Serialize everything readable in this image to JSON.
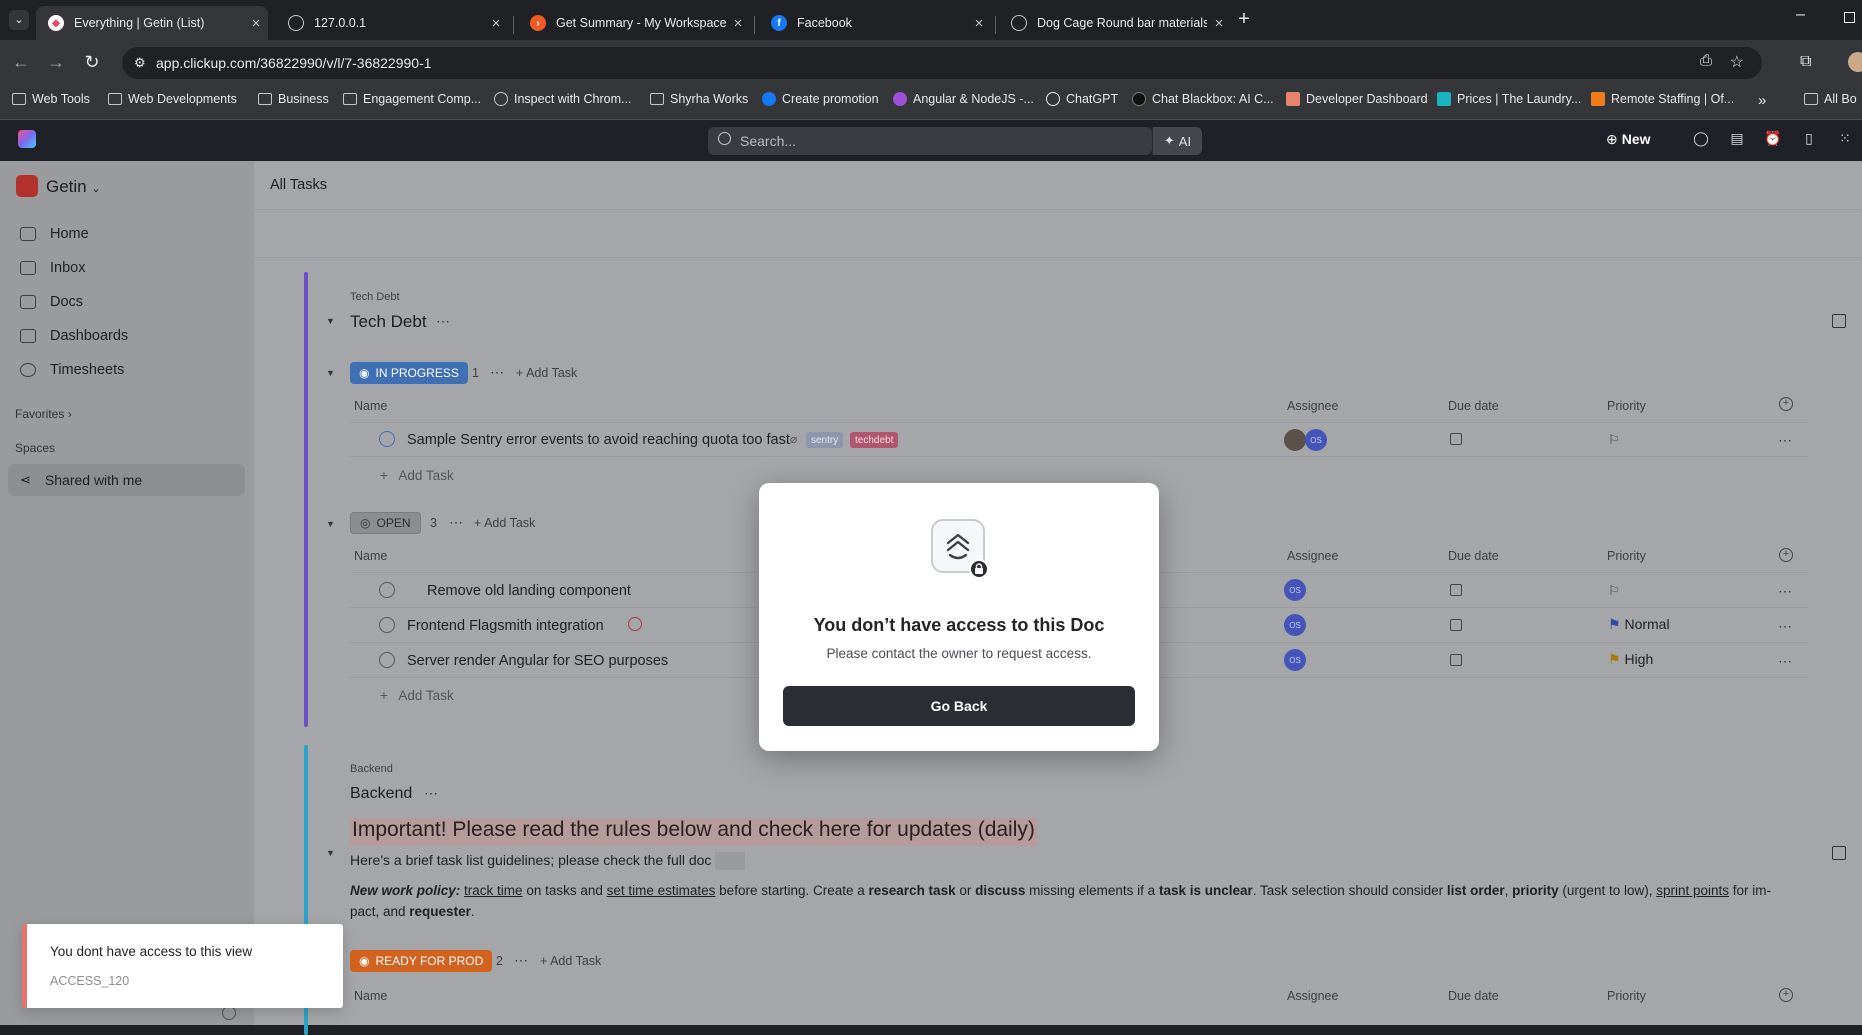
{
  "browser": {
    "tabs": [
      {
        "title": "Everything | Getin (List)",
        "active": true,
        "favicon": "clickup-icon"
      },
      {
        "title": "127.0.0.1",
        "active": false,
        "favicon": "globe-icon"
      },
      {
        "title": "Get Summary - My Workspace",
        "active": false,
        "favicon": "postman-icon"
      },
      {
        "title": "Facebook",
        "active": false,
        "favicon": "facebook-icon"
      },
      {
        "title": "Dog Cage Round bar materials",
        "active": false,
        "favicon": "globe-icon"
      }
    ],
    "url": "app.clickup.com/36822990/v/l/7-36822990-1",
    "bookmarks": [
      "Web Tools",
      "Web Developments",
      "Business",
      "Engagement Comp...",
      "Inspect with Chrom...",
      "Shyrha Works",
      "Create promotion",
      "Angular & NodeJS -...",
      "ChatGPT",
      "Chat Blackbox: AI C...",
      "Developer Dashboard",
      "Prices | The Laundry...",
      "Remote Staffing | Of...",
      "All Bo"
    ],
    "more_bookmarks": "»"
  },
  "app": {
    "search_placeholder": "Search...",
    "ai_label": "AI",
    "new_label": "New",
    "workspace": "Getin",
    "nav": [
      "Home",
      "Inbox",
      "Docs",
      "Dashboards",
      "Timesheets"
    ],
    "favorites_label": "Favorites",
    "spaces_label": "Spaces",
    "shared_label": "Shared with me",
    "page_title": "All Tasks"
  },
  "tech_debt": {
    "breadcrumb": "Tech Debt",
    "title": "Tech Debt",
    "in_progress": {
      "status": "IN PROGRESS",
      "count": "1",
      "add_task": "Add Task",
      "columns": [
        "Name",
        "Assignee",
        "Due date",
        "Priority"
      ],
      "tasks": [
        {
          "name": "Sample Sentry error events to avoid reaching quota too fast",
          "tags": [
            "sentry",
            "techdebt"
          ]
        }
      ],
      "add_task_row": "Add Task"
    },
    "open": {
      "status": "OPEN",
      "count": "3",
      "add_task": "Add Task",
      "columns": [
        "Name",
        "Assignee",
        "Due date",
        "Priority"
      ],
      "tasks": [
        {
          "name": "Remove old landing component",
          "assignee": "OS",
          "priority": ""
        },
        {
          "name": "Frontend Flagsmith integration",
          "assignee": "OS",
          "priority": "Normal"
        },
        {
          "name": "Server render Angular for SEO purposes",
          "assignee": "OS",
          "priority": "High"
        }
      ],
      "add_task_row": "Add Task"
    }
  },
  "backend": {
    "breadcrumb": "Backend",
    "title": "Backend",
    "notice_heading": "Important! Please read the rules below and check here for updates (daily)",
    "notice_line1": "Here's a brief task list guidelines; please check the full doc",
    "policy": {
      "lead": "New work policy:",
      "p1": "track time",
      "p2": " on tasks and ",
      "p3": "set time estimates",
      "p4": " before starting. Create a ",
      "p5": "research task",
      "p6": " or ",
      "p7": "discuss",
      "p8": " missing elements if a ",
      "p9": "task is unclear",
      "p10": ". Task selection should consider ",
      "p11": "list order",
      "p12": ", ",
      "p13": "priority",
      "p14": " (urgent to low), ",
      "p15": "sprint points",
      "p16": " for im-",
      "p17": "pact, and ",
      "p18": "requester",
      "p19": "."
    },
    "ready": {
      "status": "READY FOR PROD",
      "count": "2",
      "add_task": "Add Task",
      "columns": [
        "Name",
        "Assignee",
        "Due date",
        "Priority"
      ]
    }
  },
  "modal": {
    "title": "You don’t have access to this Doc",
    "subtitle": "Please contact the owner to request access.",
    "button": "Go Back"
  },
  "toast": {
    "message": "You dont have access to this view",
    "code": "ACCESS_120"
  },
  "colors": {
    "in_progress": "#3f6fb5",
    "ready_for_prod": "#d3621f",
    "tech_debt_bar": "#6a4fc6",
    "backend_bar": "#2ba3c9",
    "toast_accent": "#e8736e"
  }
}
